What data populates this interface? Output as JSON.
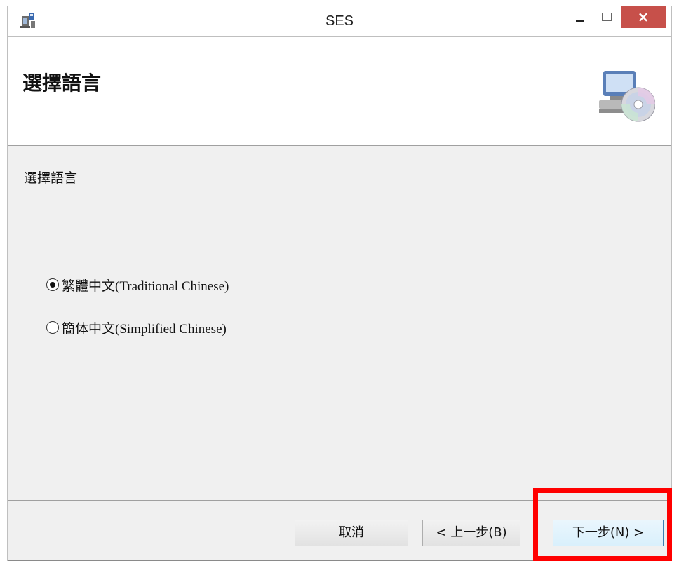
{
  "window": {
    "title": "SES",
    "close_glyph": "×"
  },
  "header": {
    "title": "選擇語言",
    "icon": "computer-cd-icon"
  },
  "main": {
    "prompt": "選擇語言",
    "options": [
      {
        "label": "繁體中文(Traditional Chinese)",
        "selected": true
      },
      {
        "label": "簡体中文(Simplified Chinese)",
        "selected": false
      }
    ]
  },
  "footer": {
    "cancel_label": "取消",
    "back_label": "< 上一步(B)",
    "next_label": "下一步(N) >"
  },
  "colors": {
    "close_button": "#c7504a",
    "highlight": "#ff0000",
    "dialog_bg": "#f0f0f0"
  }
}
